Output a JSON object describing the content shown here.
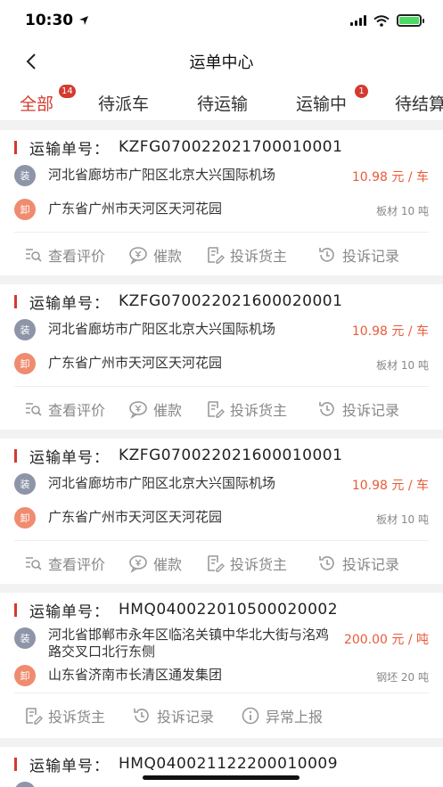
{
  "status": {
    "time": "10:30"
  },
  "nav": {
    "title": "运单中心"
  },
  "tabs": [
    {
      "label": "全部",
      "badge": "14"
    },
    {
      "label": "待派车",
      "badge": ""
    },
    {
      "label": "待运输",
      "badge": ""
    },
    {
      "label": "运输中",
      "badge": "1"
    },
    {
      "label": "待结算",
      "badge": ""
    }
  ],
  "order_label": "运输单号：",
  "orders": [
    {
      "number": "KZFG070022021700010001",
      "load_tag": "装",
      "load_addr": "河北省廊坊市广阳区北京大兴国际机场",
      "price": "10.98 元 / 车",
      "unload_tag": "卸",
      "unload_addr": "广东省广州市天河区天河花园",
      "cargo": "板材 10 吨",
      "actions": [
        "查看评价",
        "催款",
        "投诉货主",
        "投诉记录"
      ]
    },
    {
      "number": "KZFG070022021600020001",
      "load_tag": "装",
      "load_addr": "河北省廊坊市广阳区北京大兴国际机场",
      "price": "10.98 元 / 车",
      "unload_tag": "卸",
      "unload_addr": "广东省广州市天河区天河花园",
      "cargo": "板材 10 吨",
      "actions": [
        "查看评价",
        "催款",
        "投诉货主",
        "投诉记录"
      ]
    },
    {
      "number": "KZFG070022021600010001",
      "load_tag": "装",
      "load_addr": "河北省廊坊市广阳区北京大兴国际机场",
      "price": "10.98 元 / 车",
      "unload_tag": "卸",
      "unload_addr": "广东省广州市天河区天河花园",
      "cargo": "板材 10 吨",
      "actions": [
        "查看评价",
        "催款",
        "投诉货主",
        "投诉记录"
      ]
    },
    {
      "number": "HMQ040022010500020002",
      "load_tag": "装",
      "load_addr": "河北省邯郸市永年区临洺关镇中华北大街与洺鸡路交叉口北行东侧",
      "price": "200.00 元 / 吨",
      "unload_tag": "卸",
      "unload_addr": "山东省济南市长清区通发集团",
      "cargo": "钢坯 20 吨",
      "actions": [
        "投诉货主",
        "投诉记录",
        "异常上报"
      ]
    },
    {
      "number": "HMQ040021122200010009"
    }
  ],
  "colors": {
    "accent": "#d33a2f",
    "price": "#e85b3a",
    "load_tag": "#8e95a8",
    "unload_tag": "#ef8b6f"
  }
}
